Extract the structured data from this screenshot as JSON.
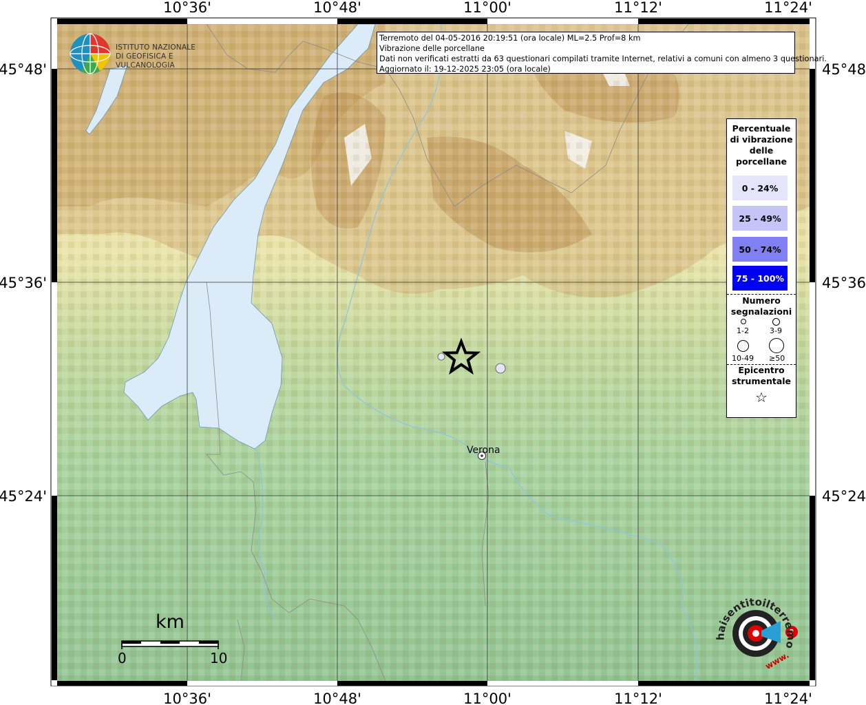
{
  "header": {
    "line1": "Terremoto del 04-05-2016 20:19:51 (ora locale) ML=2.5 Prof=8 km",
    "line2": "Vibrazione delle porcellane",
    "line3": "Dati non verificati estratti da 63 questionari compilati tramite Internet, relativi a comuni con almeno 3 questionari.",
    "line4": "Aggiornato il: 19-12-2025 23:05 (ora locale)"
  },
  "logo": {
    "line1": "ISTITUTO NAZIONALE",
    "line2": "DI GEOFISICA E VULCANOLOGIA"
  },
  "axes": {
    "top_lon": [
      "10°36'",
      "10°48'",
      "11°00'",
      "11°12'",
      "11°24'"
    ],
    "bottom_lon": [
      "10°36'",
      "10°48'",
      "11°00'",
      "11°12'",
      "11°24'"
    ],
    "left_lat": [
      "45°48'",
      "45°36'",
      "45°24'"
    ],
    "right_lat": [
      "45°48'",
      "45°36'",
      "45°24'"
    ]
  },
  "legend": {
    "title_lines": [
      "Percentuale",
      "di vibrazione",
      "delle",
      "porcellane"
    ],
    "classes": [
      {
        "label": "0 - 24%",
        "color": "#e4e4fb",
        "text_color": "#000000"
      },
      {
        "label": "25 - 49%",
        "color": "#c4c4f8",
        "text_color": "#000000"
      },
      {
        "label": "50 - 74%",
        "color": "#8080f2",
        "text_color": "#000000"
      },
      {
        "label": "75 - 100%",
        "color": "#0000f5",
        "text_color": "#ffffff"
      }
    ],
    "count_title_lines": [
      "Numero",
      "segnalazioni"
    ],
    "count_sizes": [
      "1-2",
      "3-9",
      "10-49",
      "≥50"
    ],
    "epicenter_title_lines": [
      "Epicentro",
      "strumentale"
    ],
    "epicenter_symbol": "☆"
  },
  "scale": {
    "unit": "km",
    "start": "0",
    "end": "10"
  },
  "city": {
    "name": "Verona"
  },
  "report_points": [
    {
      "class": "0 - 24%",
      "count": "1-2"
    },
    {
      "class": "0 - 24%",
      "count": "3-9"
    }
  ],
  "colors": {
    "lake": "#dcebf8",
    "plain": "#9cc89a",
    "hills": "#e8e0a6",
    "mountains": "#c4a268",
    "snow": "#f4f2ec"
  },
  "hst_logo": {
    "text": "haisentitoilterremoto.it",
    "prefix": "www."
  }
}
